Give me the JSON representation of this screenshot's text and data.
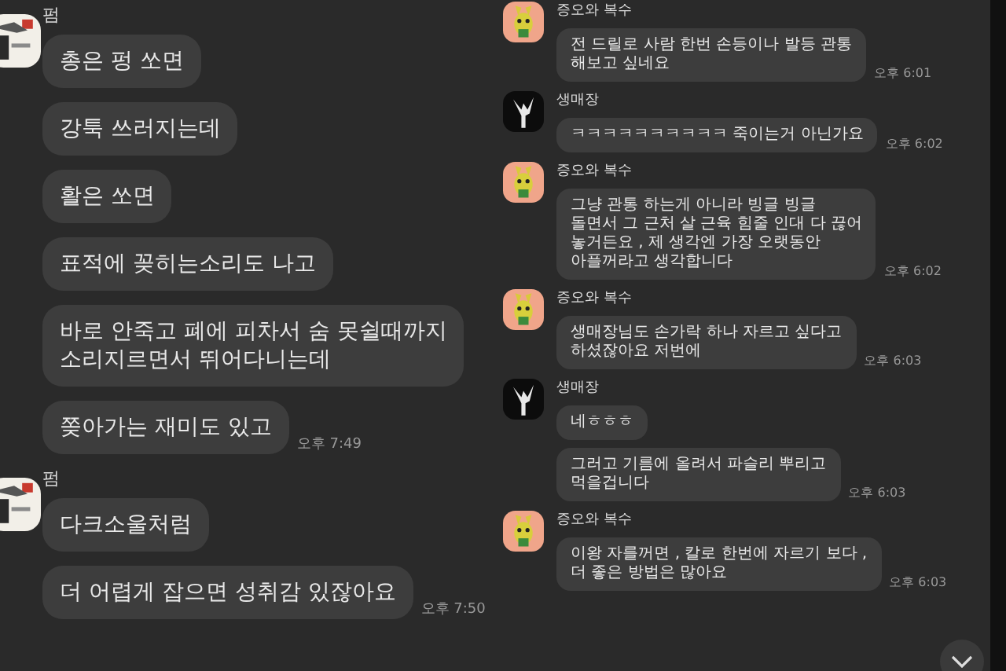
{
  "panels": [
    {
      "kind": "large",
      "groups": [
        {
          "sender": "펌",
          "bubbles": [
            {
              "text": "총은 펑 쏘면"
            },
            {
              "text": "강툭 쓰러지는데"
            },
            {
              "text": "활은 쏘면"
            },
            {
              "text": "표적에 꽂히는소리도 나고"
            },
            {
              "text": "바로 안죽고 폐에 피차서 숨 못쉴때까지\n소리지르면서 뛰어다니는데"
            },
            {
              "text": "쫒아가는 재미도 있고",
              "time": "오후 7:49"
            }
          ]
        },
        {
          "sender": "펌",
          "bubbles": [
            {
              "text": "다크소울처럼"
            },
            {
              "text": "더 어렵게 잡으면 성취감 있잖아요",
              "time": "오후 7:50"
            }
          ]
        }
      ]
    },
    {
      "kind": "small",
      "groups": [
        {
          "sender": "증오와 복수",
          "avatar": {
            "kind": "character"
          },
          "bubbles": [
            {
              "text": "전 드릴로 사람 한번 손등이나 발등 관통\n해보고 싶네요",
              "time": "오후 6:01"
            }
          ]
        },
        {
          "sender": "생매장",
          "avatar": {
            "kind": "silhouette"
          },
          "bubbles": [
            {
              "text": "ㅋㅋㅋㅋㅋㅋㅋㅋㅋㅋ 죽이는거 아닌가요",
              "time": "오후 6:02"
            }
          ]
        },
        {
          "sender": "증오와 복수",
          "avatar": {
            "kind": "character"
          },
          "bubbles": [
            {
              "text": "그냥 관통 하는게 아니라 빙글 빙글\n돌면서 그 근처 살 근육 힘줄 인대 다 끊어\n놓거든요 , 제 생각엔 가장 오랫동안\n아플꺼라고 생각합니다",
              "time": "오후 6:02"
            }
          ]
        },
        {
          "sender": "증오와 복수",
          "avatar": {
            "kind": "character"
          },
          "bubbles": [
            {
              "text": "생매장님도 손가락 하나 자르고 싶다고\n하셨잖아요 저번에",
              "time": "오후 6:03"
            }
          ]
        },
        {
          "sender": "생매장",
          "avatar": {
            "kind": "silhouette"
          },
          "bubbles": [
            {
              "text": "네ㅎㅎㅎ"
            },
            {
              "text": "그러고 기름에 올려서 파슬리 뿌리고\n먹을겁니다",
              "time": "오후 6:03"
            }
          ]
        },
        {
          "sender": "증오와 복수",
          "avatar": {
            "kind": "character"
          },
          "bubbles": [
            {
              "text": "이왕 자를꺼면 , 칼로 한번에 자르기 보다 ,\n더 좋은 방법은 많아요",
              "time": "오후 6:03"
            }
          ]
        }
      ]
    }
  ]
}
